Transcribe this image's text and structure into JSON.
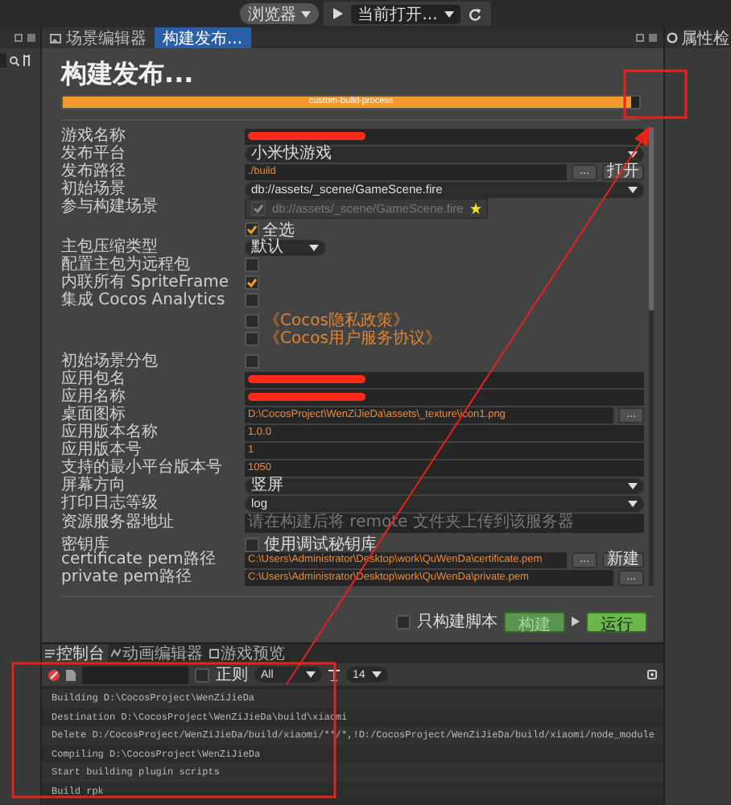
{
  "toolbar": {
    "preview_target": "浏览器",
    "scene_select": "当前打开..."
  },
  "tabs": [
    {
      "label": "场景编辑器",
      "selected": false
    },
    {
      "label": "构建发布...",
      "selected": true
    }
  ],
  "inspector": {
    "title": "属性检"
  },
  "build": {
    "title": "构建发布...",
    "progress": {
      "label": "custom-build-process",
      "level": 0.985
    },
    "rows": [
      {
        "kind": "redacted",
        "label": "游戏名称"
      },
      {
        "kind": "select",
        "label": "发布平台",
        "value": "小米快游戏"
      },
      {
        "kind": "text",
        "label": "发布路径",
        "value": "./build",
        "buttons": [
          "...",
          "打开"
        ]
      },
      {
        "kind": "select",
        "label": "初始场景",
        "value": "db://assets/_scene/GameScene.fire"
      },
      {
        "kind": "scenes",
        "label": "参与构建场景",
        "scenes": [
          {
            "path": "db://assets/_scene/GameScene.fire",
            "checked": true
          }
        ],
        "select_all": {
          "text": "全选",
          "checked": true
        }
      },
      {
        "kind": "select-small",
        "label": "主包压缩类型",
        "value": "默认"
      },
      {
        "kind": "checkbox",
        "label": "配置主包为远程包",
        "checked": false
      },
      {
        "kind": "checkbox",
        "label": "内联所有 SpriteFrame",
        "checked": true
      },
      {
        "kind": "checkbox",
        "label": "集成 Cocos Analytics",
        "checked": false
      },
      {
        "kind": "link",
        "text": "《Cocos隐私政策》",
        "checked": false
      },
      {
        "kind": "link",
        "text": "《Cocos用户服务协议》",
        "checked": false
      },
      {
        "kind": "checkbox",
        "label": "初始场景分包",
        "checked": false,
        "spaced": true
      },
      {
        "kind": "redacted",
        "label": "应用包名"
      },
      {
        "kind": "redacted",
        "label": "应用名称"
      },
      {
        "kind": "text",
        "label": "桌面图标",
        "value": "D:\\CocosProject\\WenZiJieDa\\assets\\_texture\\icon1.png",
        "buttons": [
          "..."
        ]
      },
      {
        "kind": "text",
        "label": "应用版本名称",
        "value": "1.0.0"
      },
      {
        "kind": "text",
        "label": "应用版本号",
        "value": "1"
      },
      {
        "kind": "text",
        "label": "支持的最小平台版本号",
        "value": "1050"
      },
      {
        "kind": "select",
        "label": "屏幕方向",
        "value": "竖屏"
      },
      {
        "kind": "select",
        "label": "打印日志等级",
        "value": "log"
      },
      {
        "kind": "text",
        "label": "资源服务器地址",
        "placeholder": "请在构建后将 remote 文件夹上传到该服务器"
      },
      {
        "kind": "checkbox",
        "label": "密钥库",
        "text": "使用调试秘钥库",
        "checked": false
      },
      {
        "kind": "text",
        "label": "certificate pem路径",
        "value": "C:\\Users\\Administrator\\Desktop\\work\\QuWenDa\\certificate.pem",
        "buttons": [
          "...",
          "新建"
        ]
      },
      {
        "kind": "text",
        "label": "private pem路径",
        "value": "C:\\Users\\Administrator\\Desktop\\work\\QuWenDa\\private.pem",
        "buttons": [
          "..."
        ]
      }
    ],
    "footer": {
      "script_only": {
        "text": "只构建脚本",
        "checked": false
      },
      "buttons": [
        {
          "label": "构建",
          "disabled": true
        },
        {
          "label": "运行",
          "disabled": false
        }
      ]
    }
  },
  "console": {
    "tabs": [
      {
        "label": "控制台",
        "selected": true
      },
      {
        "label": "动画编辑器",
        "selected": false
      },
      {
        "label": "游戏预览",
        "selected": false
      }
    ],
    "filter": {
      "regex": {
        "text": "正则",
        "checked": false
      },
      "level": "All",
      "font_size": "14"
    },
    "lines": [
      "Building D:\\CocosProject\\WenZiJieDa",
      "Destination D:\\CocosProject\\WenZiJieDa\\build\\xiaomi",
      "Delete D:/CocosProject/WenZiJieDa/build/xiaomi/**/*,!D:/CocosProject/WenZiJieDa/build/xiaomi/node_module",
      "Compiling D:\\CocosProject\\WenZiJieDa",
      "Start building plugin scripts",
      "Build rpk"
    ]
  }
}
